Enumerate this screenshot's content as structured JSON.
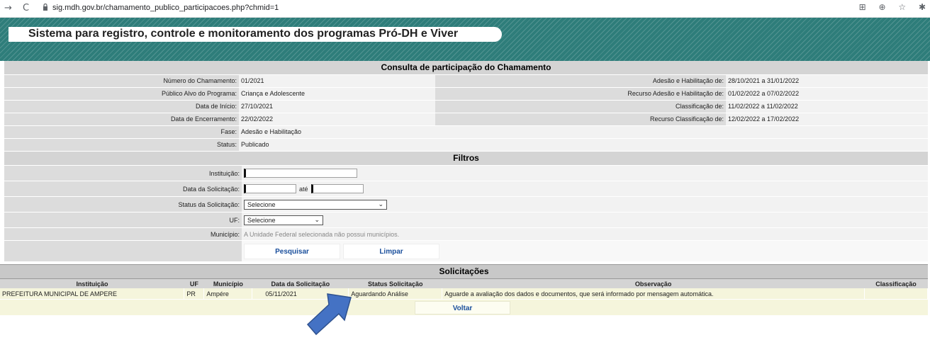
{
  "browser": {
    "back": "→",
    "reload": "C",
    "url": "sig.mdh.gov.br/chamamento_publico_participacoes.php?chmid=1",
    "icons": [
      "qr-icon",
      "zoom-icon",
      "star-icon",
      "extension-icon"
    ]
  },
  "header": {
    "title": "Sistema para registro, controle e monitoramento dos programas Pró-DH e Viver"
  },
  "consulta": {
    "title": "Consulta de participação do Chamamento",
    "left": [
      {
        "label": "Número do Chamamento:",
        "value": "01/2021"
      },
      {
        "label": "Público Alvo do Programa:",
        "value": "Criança e Adolescente"
      },
      {
        "label": "Data de Início:",
        "value": "27/10/2021"
      },
      {
        "label": "Data de Encerramento:",
        "value": "22/02/2022"
      },
      {
        "label": "Fase:",
        "value": "Adesão e Habilitação"
      },
      {
        "label": "Status:",
        "value": "Publicado"
      }
    ],
    "right": [
      {
        "label": "Adesão e Habilitação de:",
        "value": "28/10/2021 a 31/01/2022"
      },
      {
        "label": "Recurso Adesão e Habilitação de:",
        "value": "01/02/2022 a 07/02/2022"
      },
      {
        "label": "Classificação de:",
        "value": "11/02/2022 a 11/02/2022"
      },
      {
        "label": "Recurso Classificação de:",
        "value": "12/02/2022 a 17/02/2022"
      }
    ]
  },
  "filtros": {
    "title": "Filtros",
    "instituicao_label": "Instituição:",
    "instituicao_value": "",
    "data_label": "Data da Solicitação:",
    "data_de": "",
    "ate_label": "até",
    "data_ate": "",
    "status_label": "Status da Solicitação:",
    "status_value": "Selecione",
    "uf_label": "UF:",
    "uf_value": "Selecione",
    "municipio_label": "Município:",
    "municipio_value": "A Unidade Federal selecionada não possui municípios.",
    "pesquisar": "Pesquisar",
    "limpar": "Limpar"
  },
  "solicitacoes": {
    "title": "Solicitações",
    "columns": [
      "Instituição",
      "UF",
      "Município",
      "Data da Solicitação",
      "Status Solicitação",
      "Observação",
      "Classificação"
    ],
    "rows": [
      {
        "instituicao": "PREFEITURA MUNICIPAL DE AMPERE",
        "uf": "PR",
        "municipio": "Ampére",
        "data": "05/11/2021",
        "status": "Aguardando Análise",
        "observacao": "Aguarde a avaliação dos dados e documentos, que será informado por mensagem automática.",
        "classificacao": ""
      }
    ],
    "voltar": "Voltar"
  },
  "colors": {
    "banner": "#2e7d7a",
    "link_blue": "#1a4f9c",
    "row_beige": "#f5f5dc",
    "arrow": "#4472c4"
  }
}
